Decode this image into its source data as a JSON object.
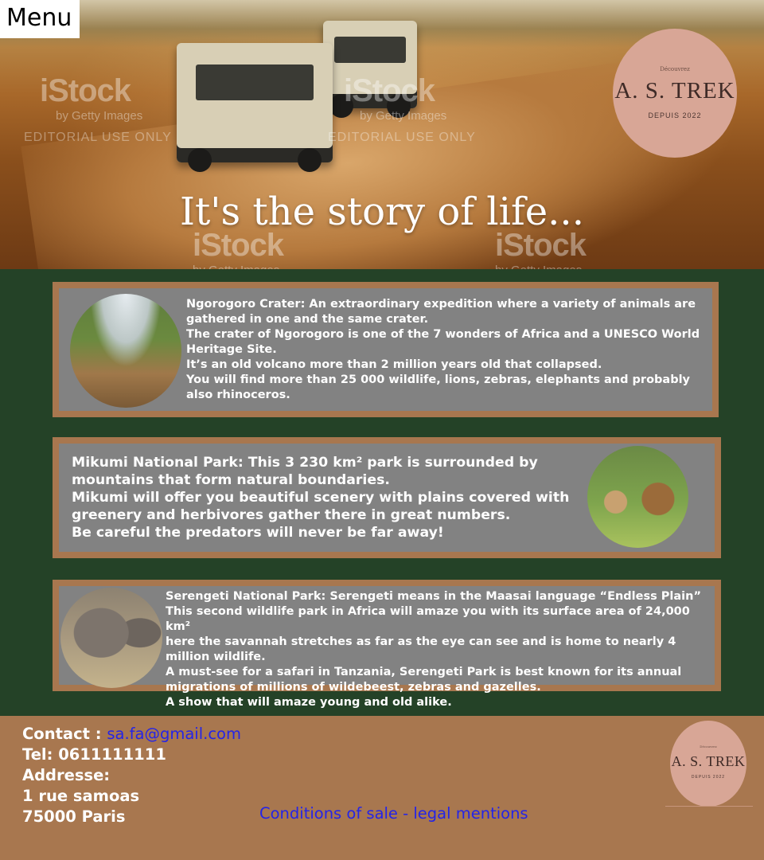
{
  "menu": {
    "label": "Menu"
  },
  "hero": {
    "title": "It's the story of life...",
    "logo": {
      "kicker": "Découvrez",
      "name": "A. S. TREK",
      "since": "DEPUIS 2022"
    },
    "watermark": {
      "brand": "iStock",
      "by": "by Getty Images",
      "editorial": "EDITORIAL USE ONLY"
    }
  },
  "cards": [
    {
      "lines": [
        "Ngorogoro Crater: An extraordinary expedition where a variety of animals are gathered in one and the same crater.",
        "The crater of Ngorogoro is one of the 7 wonders of Africa and a UNESCO World Heritage Site.",
        "It’s an old volcano more than 2 million years old that collapsed.",
        "You will find more than 25 000 wildlife, lions, zebras, elephants and probably also rhinoceros."
      ]
    },
    {
      "lines": [
        "Mikumi National Park: This 3 230 km² park is surrounded by mountains that form natural boundaries.",
        "Mikumi will offer you beautiful scenery with plains covered with greenery and herbivores gather there in great numbers.",
        "Be careful the predators will never be far away!"
      ]
    },
    {
      "lines": [
        "Serengeti National Park: Serengeti means in the Maasai language “Endless Plain”",
        "This second wildlife park in Africa will amaze you with its surface area of 24,000 km²",
        "here the savannah stretches as far as the eye can see and is home to nearly 4 million wildlife.",
        "A must-see for a safari in Tanzania, Serengeti Park is best known for its annual migrations of millions of wildebeest, zebras and gazelles.",
        "A show that will amaze young and old alike."
      ]
    }
  ],
  "footer": {
    "contact_label": "Contact :",
    "email": "sa.fa@gmail.com",
    "tel": "Tel: 0611111111",
    "address_label": "Addresse:",
    "street": "1 rue samoas",
    "city": "75000 Paris",
    "legal_link": "Conditions of sale - legal mentions",
    "logo": {
      "kicker": "Découvrez",
      "name": "A. S. TREK",
      "since": "DEPUIS 2022"
    }
  },
  "colors": {
    "page_bg": "#244227",
    "card_bg": "#828282",
    "card_border": "#a8774f",
    "footer_bg": "#a8774f",
    "link": "#2424e8",
    "logo_bg": "#d8a696"
  }
}
